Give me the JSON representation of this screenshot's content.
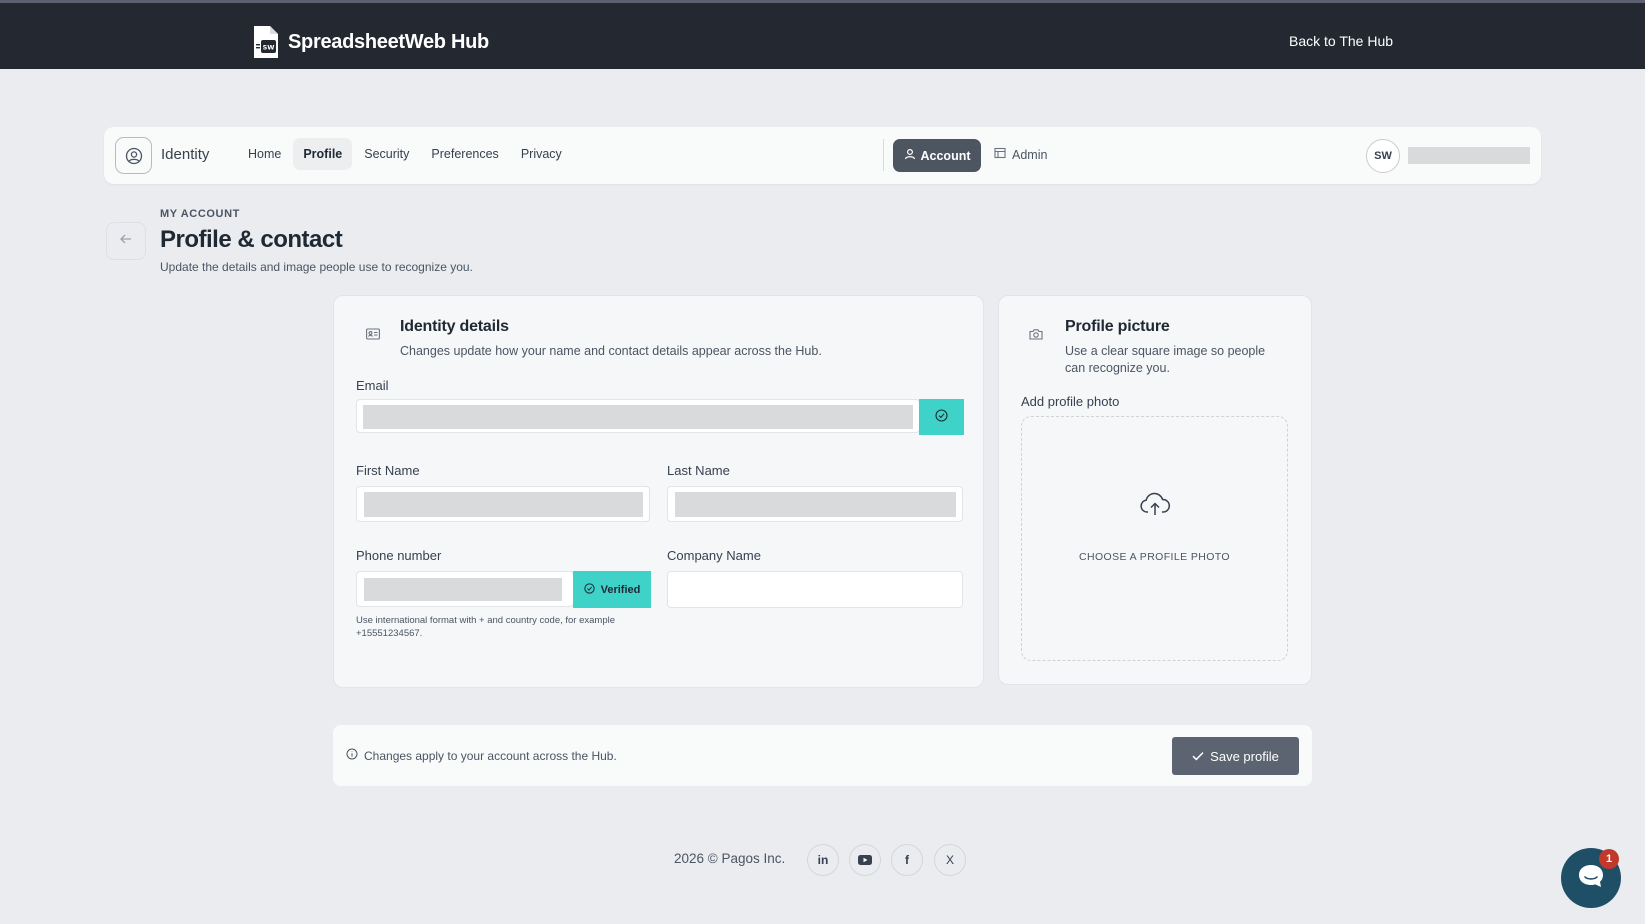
{
  "topbar": {
    "brand_name": "SpreadsheetWeb Hub",
    "back_link": "Back to The Hub"
  },
  "nav": {
    "section_label": "Identity",
    "links": [
      {
        "label": "Home"
      },
      {
        "label": "Profile",
        "active": true
      },
      {
        "label": "Security"
      },
      {
        "label": "Preferences"
      },
      {
        "label": "Privacy"
      }
    ],
    "account_label": "Account",
    "admin_label": "Admin",
    "avatar_initials": "SW"
  },
  "header": {
    "eyebrow": "MY ACCOUNT",
    "title": "Profile & contact",
    "subtitle": "Update the details and image people use to recognize you."
  },
  "identity_card": {
    "title": "Identity details",
    "subtitle": "Changes update how your name and contact details appear across the Hub.",
    "email_label": "Email",
    "first_name_label": "First Name",
    "last_name_label": "Last Name",
    "phone_label": "Phone number",
    "phone_verified": "Verified",
    "phone_hint": "Use international format with + and country code, for example +15551234567.",
    "company_label": "Company Name",
    "company_value": ""
  },
  "picture_card": {
    "title": "Profile picture",
    "subtitle": "Use a clear square image so people can recognize you.",
    "add_label": "Add profile photo",
    "upload_label": "CHOOSE A PROFILE PHOTO"
  },
  "savebar": {
    "info": "Changes apply to your account across the Hub.",
    "save_label": "Save profile"
  },
  "footer": {
    "copyright": "2026 © Pagos Inc.",
    "social": [
      "in",
      "youtube",
      "f",
      "X"
    ]
  },
  "chat": {
    "badge": "1"
  },
  "colors": {
    "topbar": "#242830",
    "accent_teal": "#3ed2c9",
    "primary_button": "#5b6470",
    "chat": "#1f4f66"
  }
}
